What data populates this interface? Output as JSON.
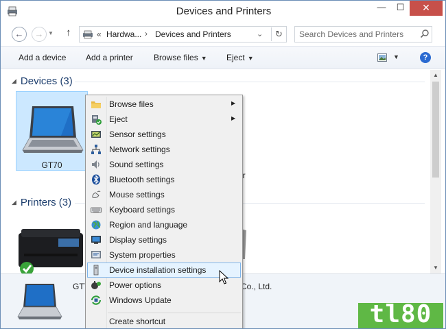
{
  "window": {
    "title": "Devices and Printers",
    "controls": {
      "minimize": "—",
      "maximize": "☐",
      "close": "✕"
    }
  },
  "address_bar": {
    "back": "←",
    "forward": "→",
    "up": "↑",
    "breadcrumb_chevron": "«",
    "crumb_1": "Hardwa...",
    "separator": "›",
    "crumb_2": "Devices and Printers",
    "dropdown": "⌄",
    "refresh": "↻"
  },
  "search": {
    "placeholder": "Search Devices and Printers"
  },
  "command_bar": {
    "add_device": "Add a device",
    "add_printer": "Add a printer",
    "browse_files": "Browse files",
    "eject": "Eject",
    "help": "?"
  },
  "groups": {
    "devices": {
      "label": "Devices (3)",
      "selected_device": "GT70",
      "partial_text": "er"
    },
    "printers": {
      "label": "Printers (3)"
    }
  },
  "details_pane": {
    "name_partial": "GT7",
    "manufacturer_partial": "Co., Ltd."
  },
  "context_menu": {
    "items": [
      {
        "label": "Browse files",
        "icon": "folder-icon",
        "submenu": true
      },
      {
        "label": "Eject",
        "icon": "eject-icon",
        "submenu": true
      },
      {
        "label": "Sensor settings",
        "icon": "sensor-icon",
        "submenu": false
      },
      {
        "label": "Network settings",
        "icon": "network-icon",
        "submenu": false
      },
      {
        "label": "Sound settings",
        "icon": "speaker-icon",
        "submenu": false
      },
      {
        "label": "Bluetooth settings",
        "icon": "bluetooth-icon",
        "submenu": false
      },
      {
        "label": "Mouse settings",
        "icon": "mouse-icon",
        "submenu": false
      },
      {
        "label": "Keyboard settings",
        "icon": "keyboard-icon",
        "submenu": false
      },
      {
        "label": "Region and language",
        "icon": "globe-icon",
        "submenu": false
      },
      {
        "label": "Display settings",
        "icon": "monitor-icon",
        "submenu": false
      },
      {
        "label": "System properties",
        "icon": "system-icon",
        "submenu": false
      },
      {
        "label": "Device installation settings",
        "icon": "device-install-icon",
        "submenu": false,
        "highlighted": true
      },
      {
        "label": "Power options",
        "icon": "power-icon",
        "submenu": false
      },
      {
        "label": "Windows Update",
        "icon": "windows-update-icon",
        "submenu": false
      },
      {
        "label": "Create shortcut",
        "icon": "",
        "submenu": false
      }
    ],
    "submenu_arrow": "▶"
  },
  "watermark": {
    "text": "tl80"
  },
  "colors": {
    "selection_fill": "#cce8ff",
    "menu_highlight": "#e5f3ff",
    "group_header": "#1e3f6e",
    "close_button": "#c7504a",
    "watermark": "#5fb845"
  }
}
